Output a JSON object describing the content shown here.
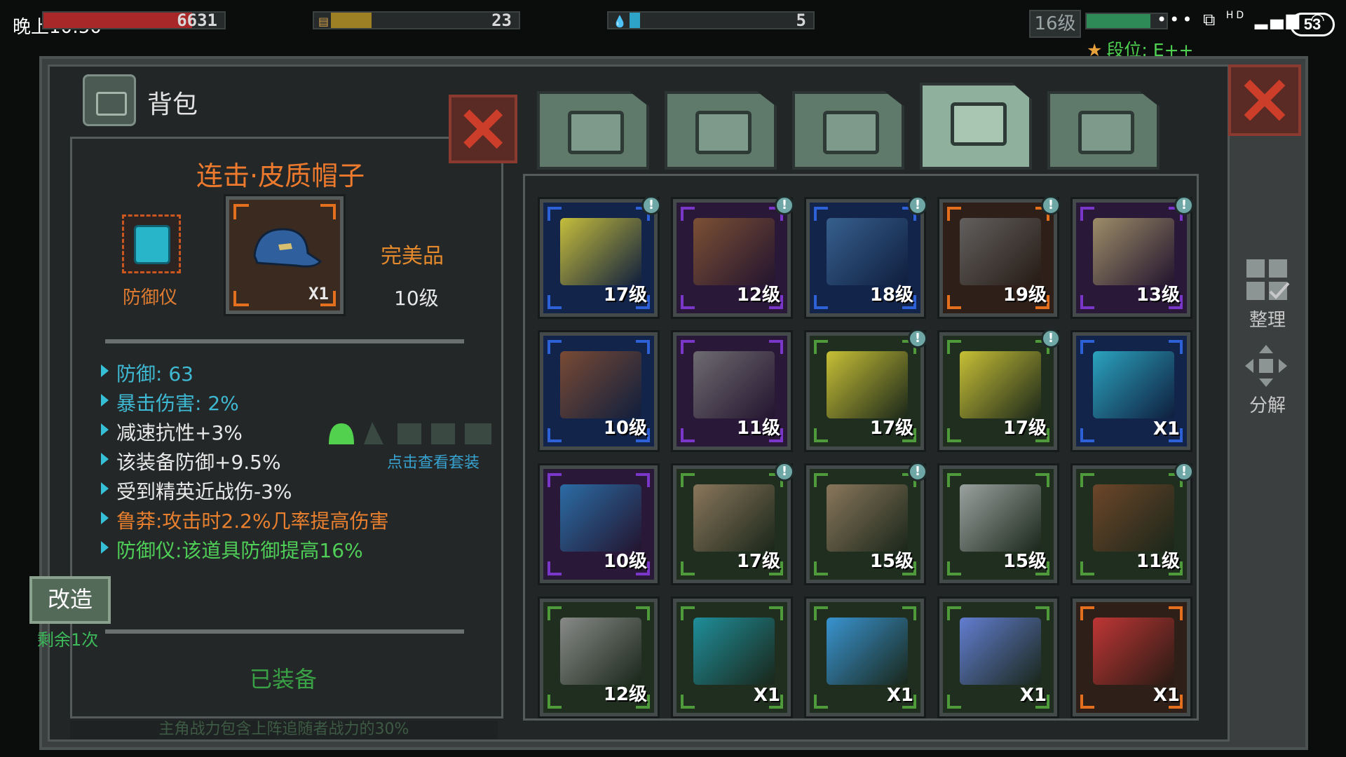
{
  "status": {
    "time": "晚上10:50",
    "hp_value": "6631",
    "food_value": "23",
    "water_value": "5",
    "hp_fill": 0.82,
    "food_fill": 0.2,
    "water_fill": 0.05,
    "player_level": "16级",
    "rank": "段位: E++",
    "battery": "53",
    "network": "HD"
  },
  "bag": {
    "title": "背包"
  },
  "detail": {
    "item_name": "连击·皮质帽子",
    "item_count": "X1",
    "device_label": "防御仪",
    "quality": "完美品",
    "level": "10级",
    "stats": [
      {
        "text": "防御: 63",
        "color": "#3fb9d3"
      },
      {
        "text": "暴击伤害: 2%",
        "color": "#3fb9d3"
      },
      {
        "text": "减速抗性+3%",
        "color": "#e8e8e8"
      },
      {
        "text": "该装备防御+9.5%",
        "color": "#e8e8e8"
      },
      {
        "text": "受到精英近战伤-3%",
        "color": "#e8e8e8"
      },
      {
        "text": "鲁莽:攻击时2.2%几率提高伤害",
        "color": "#e9802f"
      },
      {
        "text": "防御仪:该道具防御提高16%",
        "color": "#4fcf58"
      }
    ],
    "set_link": "点击查看套装",
    "modify_button": "改造",
    "remaining": "剩余1次",
    "equipped": "已装备",
    "footer_note": "主角战力包含上阵追随者战力的30%"
  },
  "tabs": [
    {
      "name": "backpack",
      "active": false
    },
    {
      "name": "medkit",
      "active": false
    },
    {
      "name": "armor",
      "active": false
    },
    {
      "name": "weapons",
      "active": true
    },
    {
      "name": "tools",
      "active": false
    }
  ],
  "side": {
    "sort_label": "整理",
    "dismantle_label": "分解"
  },
  "colors": {
    "orange": "#e46f1d",
    "blue": "#2e61d8",
    "purple": "#7a36c9",
    "green": "#4f9a3a"
  },
  "items": [
    {
      "name": "energy-pistol",
      "level": "17级",
      "rarity": "blue",
      "badge": true,
      "art": "#e5d93a"
    },
    {
      "name": "boots",
      "level": "12级",
      "rarity": "purple",
      "badge": true,
      "art": "#8a5a33"
    },
    {
      "name": "baseball-cap",
      "level": "18级",
      "rarity": "blue",
      "badge": true,
      "art": "#3d6a9a"
    },
    {
      "name": "crossbow",
      "level": "19级",
      "rarity": "orange",
      "badge": true,
      "art": "#6b6b6b"
    },
    {
      "name": "khaki-pants",
      "level": "13级",
      "rarity": "purple",
      "badge": true,
      "art": "#b0a170"
    },
    {
      "name": "assault-rifle",
      "level": "10级",
      "rarity": "blue",
      "badge": false,
      "art": "#8b5130"
    },
    {
      "name": "handgun",
      "level": "11级",
      "rarity": "purple",
      "badge": false,
      "art": "#7a7a7a"
    },
    {
      "name": "energy-pistol",
      "level": "17级",
      "rarity": "green",
      "badge": true,
      "art": "#e5d93a"
    },
    {
      "name": "energy-pistol",
      "level": "17级",
      "rarity": "green",
      "badge": true,
      "art": "#e5d93a"
    },
    {
      "name": "defense-device",
      "level": "X1",
      "rarity": "blue",
      "badge": false,
      "art": "#2fb9d2"
    },
    {
      "name": "blue-jacket",
      "level": "10级",
      "rarity": "purple",
      "badge": false,
      "art": "#2b7bb8"
    },
    {
      "name": "tactical-vest",
      "level": "17级",
      "rarity": "green",
      "badge": true,
      "art": "#9c8366"
    },
    {
      "name": "tactical-vest",
      "level": "15级",
      "rarity": "green",
      "badge": true,
      "art": "#9c8366"
    },
    {
      "name": "machete",
      "level": "15级",
      "rarity": "green",
      "badge": false,
      "art": "#b0b6b6"
    },
    {
      "name": "leather-jacket",
      "level": "11级",
      "rarity": "green",
      "badge": true,
      "art": "#7a4a2b"
    },
    {
      "name": "axe",
      "level": "12级",
      "rarity": "green",
      "badge": false,
      "art": "#9a9a9a"
    },
    {
      "name": "scanner-device",
      "level": "X1",
      "rarity": "green",
      "badge": false,
      "art": "#1f9fb0"
    },
    {
      "name": "energy-core",
      "level": "X1",
      "rarity": "green",
      "badge": false,
      "art": "#3da6f0"
    },
    {
      "name": "crystal-core",
      "level": "X1",
      "rarity": "green",
      "badge": false,
      "art": "#6e8cf0"
    },
    {
      "name": "weapon-device",
      "level": "X1",
      "rarity": "orange",
      "badge": false,
      "art": "#d83a3a"
    }
  ]
}
